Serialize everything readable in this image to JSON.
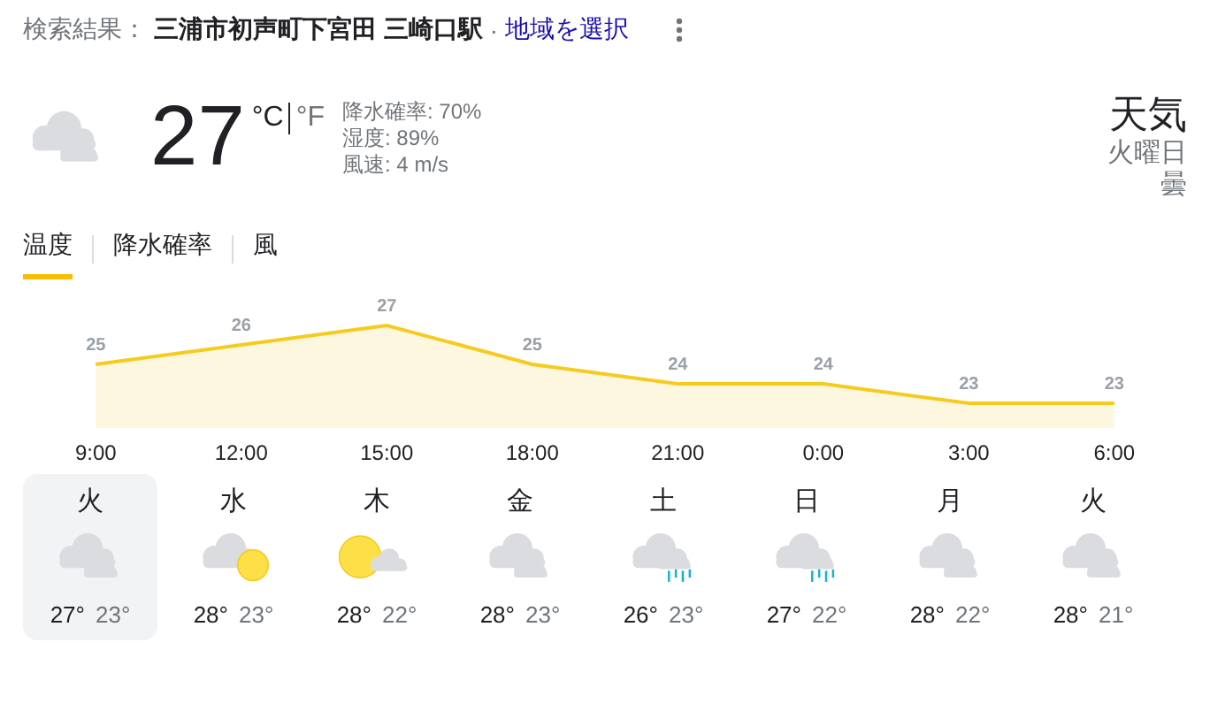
{
  "header": {
    "prefix": "検索結果：",
    "location": "三浦市初声町下宮田 三崎口駅",
    "separator": "·",
    "link": "地域を選択"
  },
  "current": {
    "kind": "cloudy",
    "temperature": "27",
    "units": [
      {
        "label": "°C",
        "selected": true
      },
      {
        "label": "°F",
        "selected": false
      }
    ],
    "details": [
      "降水確率: 70%",
      "湿度: 89%",
      "風速: 4 m/s"
    ]
  },
  "summary": {
    "title": "天気",
    "day": "火曜日",
    "condition": "曇"
  },
  "tabs": [
    {
      "label": "温度",
      "selected": true
    },
    {
      "label": "降水確率",
      "selected": false
    },
    {
      "label": "風",
      "selected": false
    }
  ],
  "chart_data": {
    "type": "area",
    "categories": [
      "9:00",
      "12:00",
      "15:00",
      "18:00",
      "21:00",
      "0:00",
      "3:00",
      "6:00"
    ],
    "series": [
      {
        "color": "#f5cc1e",
        "values": [
          25,
          26,
          27,
          25,
          24,
          24,
          23,
          23
        ]
      }
    ],
    "data_labels": true
  },
  "days": [
    {
      "day": "火",
      "kind": "cloudy",
      "high": "27°",
      "low": "23°",
      "selected": true
    },
    {
      "day": "水",
      "kind": "cloud_sun",
      "high": "28°",
      "low": "23°",
      "selected": false
    },
    {
      "day": "木",
      "kind": "sun_cloud",
      "high": "28°",
      "low": "22°",
      "selected": false
    },
    {
      "day": "金",
      "kind": "cloudy",
      "high": "28°",
      "low": "23°",
      "selected": false
    },
    {
      "day": "土",
      "kind": "rain",
      "high": "26°",
      "low": "23°",
      "selected": false
    },
    {
      "day": "日",
      "kind": "rain",
      "high": "27°",
      "low": "22°",
      "selected": false
    },
    {
      "day": "月",
      "kind": "cloudy",
      "high": "28°",
      "low": "22°",
      "selected": false
    },
    {
      "day": "火",
      "kind": "cloudy",
      "high": "28°",
      "low": "21°",
      "selected": false
    }
  ]
}
